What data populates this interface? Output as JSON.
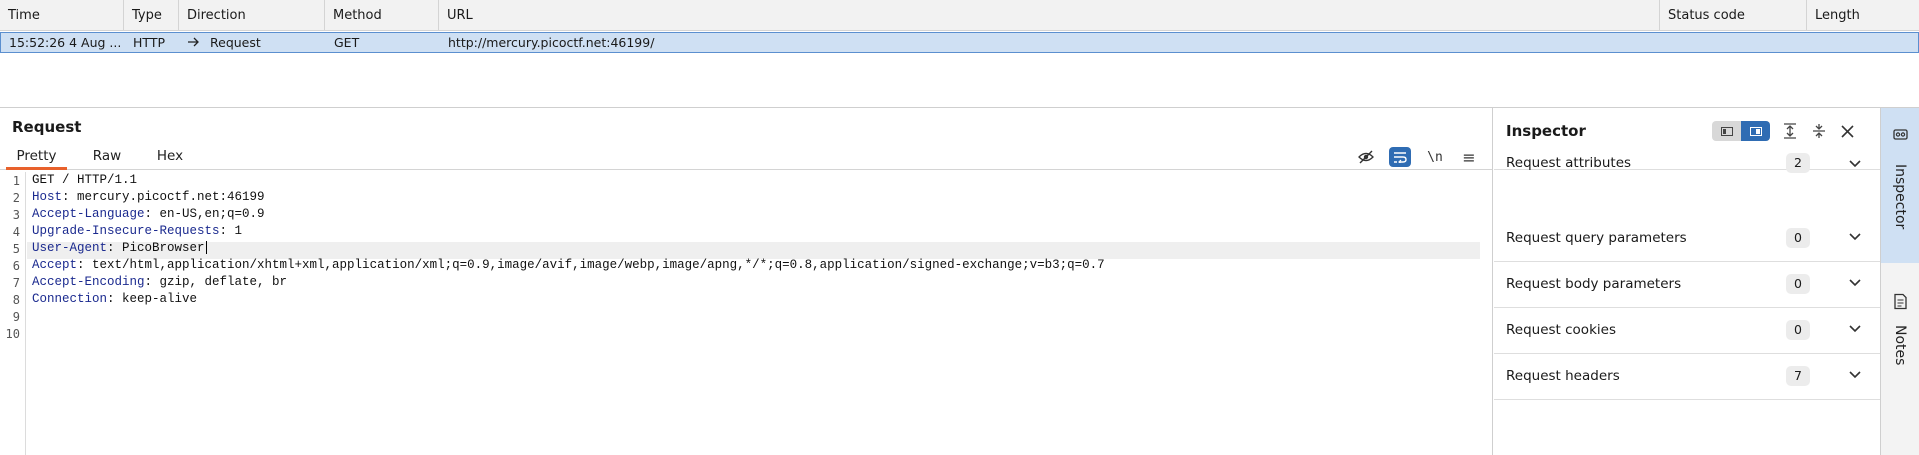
{
  "history": {
    "columns": [
      "Time",
      "Type",
      "Direction",
      "Method",
      "URL",
      "Status code",
      "Length"
    ],
    "rows": [
      {
        "time": "15:52:26 4 Aug ...",
        "type": "HTTP",
        "direction": "Request",
        "method": "GET",
        "url": "http://mercury.picoctf.net:46199/",
        "status": "",
        "length": ""
      }
    ]
  },
  "request": {
    "title": "Request",
    "tabs": [
      "Pretty",
      "Raw",
      "Hex"
    ],
    "active_tab": "Pretty",
    "newline_toggle": "\\n",
    "line_numbers": [
      "1",
      "2",
      "3",
      "4",
      "5",
      "6",
      "7",
      "8",
      "9",
      "10"
    ],
    "lines": [
      {
        "key": "GET / HTTP/1.1",
        "value": ""
      },
      {
        "key": "Host",
        "value": ": mercury.picoctf.net:46199"
      },
      {
        "key": "Accept-Language",
        "value": ": en-US,en;q=0.9"
      },
      {
        "key": "Upgrade-Insecure-Requests",
        "value": ": 1"
      },
      {
        "key": "User-Agent",
        "value": ": PicoBrowser"
      },
      {
        "key": "Accept",
        "value": ": text/html,application/xhtml+xml,application/xml;q=0.9,image/avif,image/webp,image/apng,*/*;q=0.8,application/signed-exchange;v=b3;q=0.7"
      },
      {
        "key": "Accept-Encoding",
        "value": ": gzip, deflate, br"
      },
      {
        "key": "Connection",
        "value": ": keep-alive"
      },
      {
        "key": "",
        "value": ""
      },
      {
        "key": "",
        "value": ""
      }
    ]
  },
  "inspector": {
    "title": "Inspector",
    "sections": [
      {
        "label": "Request attributes",
        "count": "2"
      },
      {
        "label": "Request query parameters",
        "count": "0"
      },
      {
        "label": "Request body parameters",
        "count": "0"
      },
      {
        "label": "Request cookies",
        "count": "0"
      },
      {
        "label": "Request headers",
        "count": "7"
      }
    ]
  },
  "rail": {
    "inspector_label": "Inspector",
    "notes_label": "Notes"
  },
  "colors": {
    "accent_tab": "#e8612c",
    "selection": "#cfe0f3",
    "toggle_active": "#2f6cb3",
    "header_key": "#1b2a8f"
  },
  "icons": {
    "direction": "arrow-right-icon",
    "toolbar": [
      "hide-eye-icon",
      "wrap-lines-icon",
      "newline-icon",
      "menu-icon"
    ],
    "inspector": [
      "layout-toggle-icon",
      "expand-all-icon",
      "collapse-all-icon",
      "close-icon",
      "chevron-down-icon"
    ],
    "rail": [
      "inspector-icon",
      "notes-icon"
    ]
  }
}
